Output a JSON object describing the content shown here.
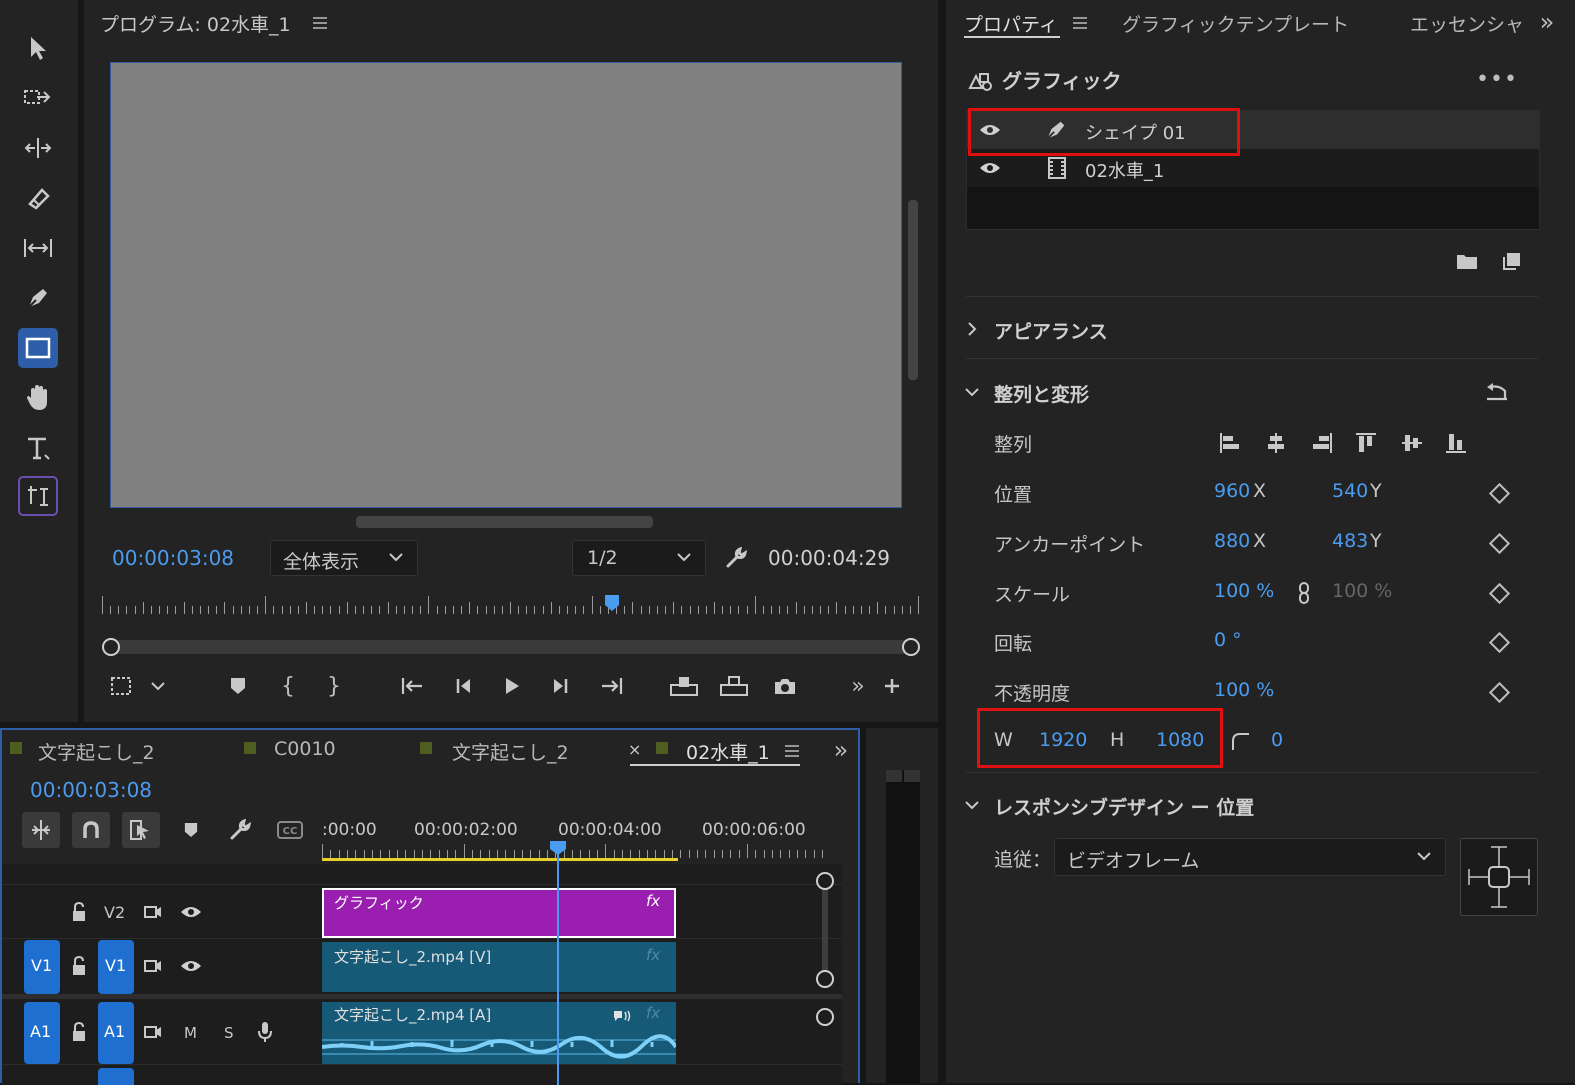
{
  "program_monitor": {
    "title": "プログラム: 02水車_1",
    "menu_icon": "hamburger-icon",
    "current_time": "00:00:03:08",
    "zoom_select": "全体表示",
    "quality_select": "1/2",
    "duration": "00:00:04:29",
    "playhead_fraction": 0.65
  },
  "tools": [
    "selection-tool-icon",
    "track-select-tool-icon",
    "ripple-edit-tool-icon",
    "razor-tool-icon",
    "slip-tool-icon",
    "pen-tool-icon",
    "rectangle-tool-icon",
    "hand-tool-icon",
    "type-tool-icon",
    "vertical-type-tool-icon"
  ],
  "properties": {
    "tabs": [
      {
        "label": "プロパティ",
        "active": true
      },
      {
        "label": "グラフィックテンプレート",
        "active": false
      },
      {
        "label": "エッセンシャ",
        "active": false
      }
    ],
    "graphic_title": "グラフィック",
    "layers": [
      {
        "name": "シェイプ 01",
        "type": "shape"
      },
      {
        "name": "02水車_1",
        "type": "clip"
      }
    ],
    "appearance_label": "アピアランス",
    "align_transform_label": "整列と変形",
    "align_label": "整列",
    "position": {
      "label": "位置",
      "x": "960",
      "y": "540"
    },
    "anchor": {
      "label": "アンカーポイント",
      "x": "880",
      "y": "483"
    },
    "scale": {
      "label": "スケール",
      "value": "100 %",
      "value2": "100 %"
    },
    "rotation": {
      "label": "回転",
      "value": "0 °"
    },
    "opacity": {
      "label": "不透明度",
      "value": "100 %"
    },
    "size": {
      "w_label": "W",
      "w": "1920",
      "h_label": "H",
      "h": "1080",
      "corner": "0"
    },
    "axis_x": "X",
    "axis_y": "Y",
    "responsive_label": "レスポンシブデザイン ー 位置",
    "follow_label": "追従：",
    "follow_value": "ビデオフレーム"
  },
  "timeline": {
    "tabs": [
      {
        "label": "文字起こし_2",
        "active": false
      },
      {
        "label": "C0010",
        "active": false
      },
      {
        "label": "文字起こし_2",
        "active": false
      },
      {
        "label": "02水車_1",
        "active": true
      }
    ],
    "close_mark": "×",
    "current_time": "00:00:03:08",
    "ruler_labels": [
      ":00:00",
      "00:00:02:00",
      "00:00:04:00",
      "00:00:06:00"
    ],
    "tracks": {
      "v2": "V2",
      "v1_target": "V1",
      "v1": "V1",
      "a1_target": "A1",
      "a1": "A1",
      "mute": "M",
      "solo": "S"
    },
    "clips": [
      {
        "name": "グラフィック",
        "fx": "fx",
        "color": "#9a1fb0"
      },
      {
        "name": "文字起こし_2.mp4 [V]",
        "fx": "fx",
        "color": "#165a78"
      },
      {
        "name": "文字起こし_2.mp4 [A]",
        "fx": "fx",
        "color": "#165a78"
      }
    ]
  },
  "colors": {
    "accent": "#4a9cf0",
    "highlight": "#e01010",
    "graphic_clip": "#9a1fb0"
  }
}
